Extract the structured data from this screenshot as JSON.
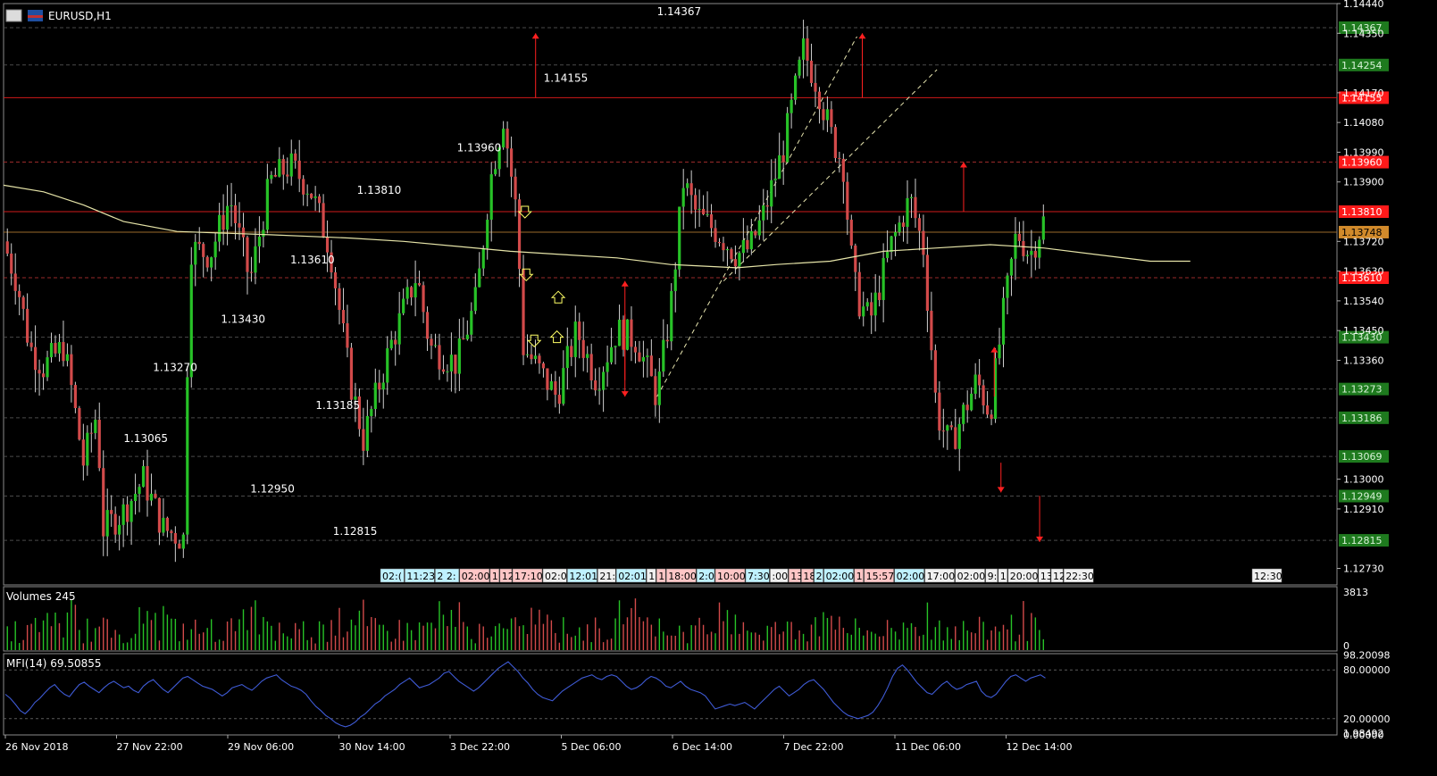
{
  "window": {
    "symbol_title": "EURUSD,H1",
    "volumes_label": "Volumes 245",
    "mfi_label": "MFI(14) 69.50855"
  },
  "colors": {
    "background": "#000000",
    "grid": "#3a3a3a",
    "bull": "#27c227",
    "bear": "#d24a4a",
    "wick": "#cfcfcf",
    "ma": "#e6e4a8",
    "mfi_line": "#3f5bd6",
    "level_line": "#d01a1a",
    "price_tag": "#d18a2b",
    "red_tag": "#ff1a1a",
    "green_tag": "#1e7a1e",
    "arrow_red": "#ff2020",
    "arrow_yellow": "#ffff66",
    "channel": "#e8e6b0"
  },
  "chart_data": [
    {
      "type": "candlestick",
      "title": "EURUSD,H1",
      "ylim": [
        1.1268,
        1.1444
      ],
      "y_ticks": [
        "1.14440",
        "1.14350",
        "1.14170",
        "1.14080",
        "1.13990",
        "1.13900",
        "1.13720",
        "1.13630",
        "1.13540",
        "1.13450",
        "1.13360",
        "1.13000",
        "1.12910",
        "1.12730"
      ],
      "x_labels": [
        "26 Nov 2018",
        "27 Nov 22:00",
        "29 Nov 06:00",
        "30 Nov 14:00",
        "3 Dec 22:00",
        "5 Dec 06:00",
        "6 Dec 14:00",
        "7 Dec 22:00",
        "11 Dec 06:00",
        "12 Dec 14:00"
      ],
      "current_price": 1.13748,
      "current_price_label": "1.13748",
      "moving_average": [
        [
          0,
          1.1389
        ],
        [
          0.03,
          1.1387
        ],
        [
          0.06,
          1.1383
        ],
        [
          0.09,
          1.1378
        ],
        [
          0.13,
          1.1375
        ],
        [
          0.2,
          1.1374
        ],
        [
          0.26,
          1.1373
        ],
        [
          0.3,
          1.1372
        ],
        [
          0.38,
          1.1369
        ],
        [
          0.42,
          1.1368
        ],
        [
          0.46,
          1.1367
        ],
        [
          0.5,
          1.1365
        ],
        [
          0.55,
          1.1364
        ],
        [
          0.58,
          1.1365
        ],
        [
          0.62,
          1.1366
        ],
        [
          0.66,
          1.1369
        ],
        [
          0.7,
          1.137
        ],
        [
          0.74,
          1.1371
        ],
        [
          0.78,
          1.137
        ],
        [
          0.82,
          1.1368
        ],
        [
          0.86,
          1.1366
        ],
        [
          0.89,
          1.1366
        ]
      ],
      "levels": [
        {
          "price": 1.14155,
          "label": "1.14155",
          "style": "solid",
          "tag": "red",
          "tag_label": "1.14155"
        },
        {
          "price": 1.1396,
          "label": "1.13960",
          "style": "dashed",
          "tag": "red",
          "tag_label": "1.13960"
        },
        {
          "price": 1.1381,
          "label": "1.13810",
          "style": "solid",
          "tag": "red",
          "tag_label": "1.13810"
        },
        {
          "price": 1.1361,
          "label": "1.13610",
          "style": "dashed",
          "tag": "red",
          "tag_label": "1.13610"
        },
        {
          "price": 1.14367,
          "label": "1.14367",
          "style": "dashed",
          "tag": "green",
          "tag_label": "1.14367"
        },
        {
          "price": 1.14254,
          "label": "",
          "style": "dashed",
          "tag": "green",
          "tag_label": "1.14254"
        },
        {
          "price": 1.1343,
          "label": "1.13430",
          "style": "dashed",
          "tag": "green",
          "tag_label": "1.13430"
        },
        {
          "price": 1.13273,
          "label": "1.13270",
          "style": "dashed",
          "tag": "green",
          "tag_label": "1.13273"
        },
        {
          "price": 1.13186,
          "label": "1.13185",
          "style": "dashed",
          "tag": "green",
          "tag_label": "1.13186"
        },
        {
          "price": 1.13069,
          "label": "1.13065",
          "style": "dashed",
          "tag": "green",
          "tag_label": "1.13069"
        },
        {
          "price": 1.12949,
          "label": "1.12950",
          "style": "dashed",
          "tag": "green",
          "tag_label": "1.12949"
        },
        {
          "price": 1.12815,
          "label": "1.12815",
          "style": "dashed",
          "tag": "green",
          "tag_label": "1.12815"
        }
      ],
      "time_strip": [
        {
          "t": "02:(",
          "c": "cyan"
        },
        {
          "t": "11:23",
          "c": "cyan"
        },
        {
          "t": "2 2:",
          "c": "cyan"
        },
        {
          "t": "02:00",
          "c": "pink"
        },
        {
          "t": "1",
          "c": "pink"
        },
        {
          "t": "12",
          "c": "pink"
        },
        {
          "t": "17:10",
          "c": "pink"
        },
        {
          "t": "02:0",
          "c": "white"
        },
        {
          "t": "12:01",
          "c": "cyan"
        },
        {
          "t": "21:",
          "c": "white"
        },
        {
          "t": "02:01",
          "c": "cyan"
        },
        {
          "t": "1",
          "c": "white"
        },
        {
          "t": "1",
          "c": "pink"
        },
        {
          "t": "18:00",
          "c": "pink"
        },
        {
          "t": "2:0",
          "c": "cyan"
        },
        {
          "t": "10:00",
          "c": "pink"
        },
        {
          "t": "7:30",
          "c": "cyan"
        },
        {
          "t": ":00",
          "c": "white"
        },
        {
          "t": "13",
          "c": "pink"
        },
        {
          "t": "18",
          "c": "pink"
        },
        {
          "t": "2",
          "c": "cyan"
        },
        {
          "t": "02:00",
          "c": "cyan"
        },
        {
          "t": "1",
          "c": "pink"
        },
        {
          "t": "15:57",
          "c": "pink"
        },
        {
          "t": "02:00",
          "c": "cyan"
        },
        {
          "t": "17:00",
          "c": "white"
        },
        {
          "t": "02:00",
          "c": "white"
        },
        {
          "t": "9:",
          "c": "white"
        },
        {
          "t": "1",
          "c": "white"
        },
        {
          "t": "20:00",
          "c": "white"
        },
        {
          "t": "13",
          "c": "white"
        },
        {
          "t": "12",
          "c": "white"
        },
        {
          "t": "22:30",
          "c": "white"
        },
        {
          "t": "12:30",
          "c": "white"
        }
      ]
    },
    {
      "type": "bar",
      "title": "Volumes 245",
      "ylim": [
        0,
        3813
      ],
      "y_ticks": [
        "3813",
        "0"
      ]
    },
    {
      "type": "line",
      "title": "MFI(14) 69.50855",
      "ylim": [
        0,
        100
      ],
      "y_ticks": [
        "98.20098",
        "80.00000",
        "20.00000",
        "1.98492",
        "0.00000"
      ],
      "levels": [
        80,
        20
      ],
      "values": [
        50,
        45,
        38,
        30,
        26,
        32,
        40,
        45,
        52,
        58,
        62,
        55,
        50,
        47,
        55,
        62,
        65,
        60,
        56,
        52,
        58,
        63,
        66,
        62,
        58,
        60,
        55,
        52,
        60,
        65,
        68,
        62,
        56,
        52,
        58,
        64,
        70,
        72,
        68,
        64,
        60,
        58,
        56,
        52,
        48,
        52,
        58,
        60,
        62,
        58,
        55,
        60,
        66,
        70,
        72,
        74,
        68,
        64,
        60,
        58,
        55,
        50,
        42,
        35,
        30,
        24,
        20,
        15,
        12,
        10,
        12,
        16,
        22,
        26,
        32,
        38,
        42,
        48,
        52,
        56,
        62,
        66,
        70,
        64,
        58,
        60,
        62,
        66,
        70,
        76,
        78,
        72,
        66,
        62,
        58,
        54,
        58,
        64,
        70,
        76,
        82,
        86,
        90,
        84,
        78,
        70,
        64,
        56,
        50,
        46,
        44,
        42,
        48,
        54,
        58,
        62,
        66,
        70,
        72,
        74,
        70,
        68,
        72,
        74,
        72,
        66,
        60,
        56,
        58,
        62,
        68,
        72,
        70,
        66,
        60,
        58,
        62,
        66,
        60,
        56,
        54,
        52,
        48,
        40,
        32,
        34,
        36,
        38,
        36,
        38,
        40,
        36,
        32,
        38,
        44,
        50,
        56,
        60,
        54,
        48,
        52,
        56,
        62,
        66,
        68,
        62,
        56,
        48,
        40,
        34,
        28,
        24,
        22,
        20,
        22,
        24,
        28,
        36,
        46,
        58,
        72,
        82,
        86,
        80,
        72,
        64,
        58,
        52,
        50,
        56,
        62,
        66,
        60,
        56,
        58,
        62,
        64,
        66,
        54,
        48,
        46,
        50,
        58,
        66,
        72,
        74,
        70,
        66,
        70,
        72,
        74,
        70
      ]
    }
  ]
}
